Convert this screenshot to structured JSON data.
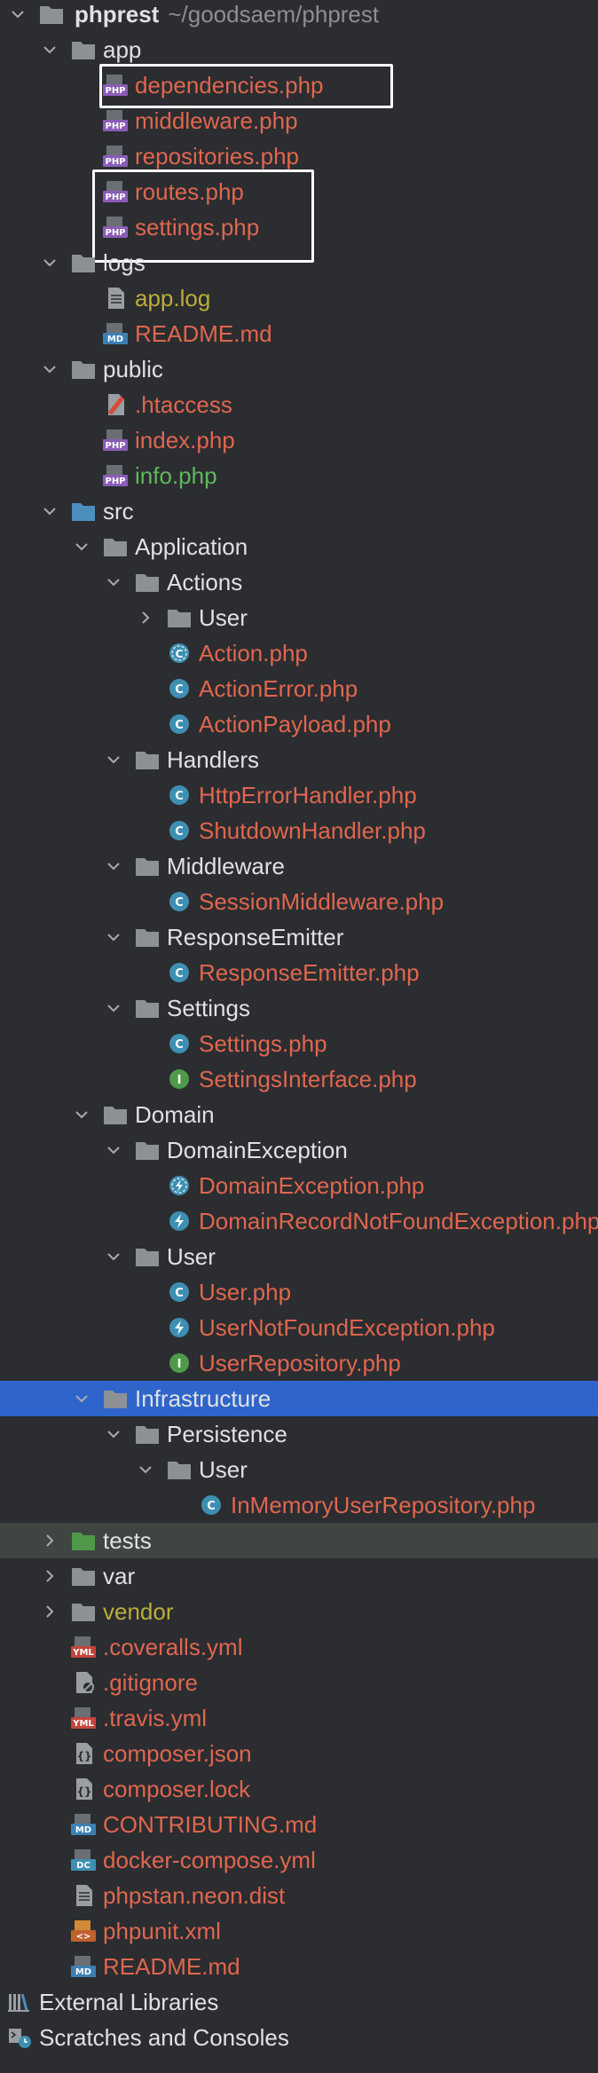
{
  "root": {
    "label": "phprest",
    "path": "~/goodsaem/phprest"
  },
  "colors": {
    "background": "#2b2d30",
    "selected_row": "#2f65ca",
    "highlight_row": "#3f4541",
    "modified_file": "#e0664f",
    "ignored_file": "#bcad3a",
    "new_file": "#5fb85c",
    "default_text": "#dfe1e5"
  },
  "rows": [
    {
      "label": "app",
      "icon": "folder-icon",
      "arrow": "expanded",
      "depth": 1,
      "color": "white"
    },
    {
      "label": "dependencies.php",
      "icon": "php-file-icon",
      "depth": 2,
      "color": "red"
    },
    {
      "label": "middleware.php",
      "icon": "php-file-icon",
      "depth": 2,
      "color": "red"
    },
    {
      "label": "repositories.php",
      "icon": "php-file-icon",
      "depth": 2,
      "color": "red"
    },
    {
      "label": "routes.php",
      "icon": "php-file-icon",
      "depth": 2,
      "color": "red"
    },
    {
      "label": "settings.php",
      "icon": "php-file-icon",
      "depth": 2,
      "color": "red"
    },
    {
      "label": "logs",
      "icon": "folder-icon",
      "arrow": "expanded",
      "depth": 1,
      "color": "white"
    },
    {
      "label": "app.log",
      "icon": "text-file-icon",
      "depth": 2,
      "color": "yellow"
    },
    {
      "label": "README.md",
      "icon": "markdown-file-icon",
      "depth": 2,
      "color": "red"
    },
    {
      "label": "public",
      "icon": "folder-icon",
      "arrow": "expanded",
      "depth": 1,
      "color": "white"
    },
    {
      "label": ".htaccess",
      "icon": "htaccess-file-icon",
      "depth": 2,
      "color": "red"
    },
    {
      "label": "index.php",
      "icon": "php-file-icon",
      "depth": 2,
      "color": "red"
    },
    {
      "label": "info.php",
      "icon": "php-file-icon",
      "depth": 2,
      "color": "green"
    },
    {
      "label": "src",
      "icon": "source-folder-icon",
      "arrow": "expanded",
      "depth": 1,
      "color": "white"
    },
    {
      "label": "Application",
      "icon": "folder-icon",
      "arrow": "expanded",
      "depth": 2,
      "color": "white"
    },
    {
      "label": "Actions",
      "icon": "folder-icon",
      "arrow": "expanded",
      "depth": 3,
      "color": "white"
    },
    {
      "label": "User",
      "icon": "folder-icon",
      "arrow": "collapsed",
      "depth": 4,
      "color": "white"
    },
    {
      "label": "Action.php",
      "icon": "abstract-class-icon",
      "depth": 4,
      "color": "red"
    },
    {
      "label": "ActionError.php",
      "icon": "class-icon",
      "depth": 4,
      "color": "red"
    },
    {
      "label": "ActionPayload.php",
      "icon": "class-icon",
      "depth": 4,
      "color": "red"
    },
    {
      "label": "Handlers",
      "icon": "folder-icon",
      "arrow": "expanded",
      "depth": 3,
      "color": "white"
    },
    {
      "label": "HttpErrorHandler.php",
      "icon": "class-icon",
      "depth": 4,
      "color": "red"
    },
    {
      "label": "ShutdownHandler.php",
      "icon": "class-icon",
      "depth": 4,
      "color": "red"
    },
    {
      "label": "Middleware",
      "icon": "folder-icon",
      "arrow": "expanded",
      "depth": 3,
      "color": "white"
    },
    {
      "label": "SessionMiddleware.php",
      "icon": "class-icon",
      "depth": 4,
      "color": "red"
    },
    {
      "label": "ResponseEmitter",
      "icon": "folder-icon",
      "arrow": "expanded",
      "depth": 3,
      "color": "white"
    },
    {
      "label": "ResponseEmitter.php",
      "icon": "class-icon",
      "depth": 4,
      "color": "red"
    },
    {
      "label": "Settings",
      "icon": "folder-icon",
      "arrow": "expanded",
      "depth": 3,
      "color": "white"
    },
    {
      "label": "Settings.php",
      "icon": "class-icon",
      "depth": 4,
      "color": "red"
    },
    {
      "label": "SettingsInterface.php",
      "icon": "interface-icon",
      "depth": 4,
      "color": "red"
    },
    {
      "label": "Domain",
      "icon": "folder-icon",
      "arrow": "expanded",
      "depth": 2,
      "color": "white"
    },
    {
      "label": "DomainException",
      "icon": "folder-icon",
      "arrow": "expanded",
      "depth": 3,
      "color": "white"
    },
    {
      "label": "DomainException.php",
      "icon": "abstract-exception-icon",
      "depth": 4,
      "color": "red"
    },
    {
      "label": "DomainRecordNotFoundException.php",
      "icon": "exception-icon",
      "depth": 4,
      "color": "red"
    },
    {
      "label": "User",
      "icon": "folder-icon",
      "arrow": "expanded",
      "depth": 3,
      "color": "white"
    },
    {
      "label": "User.php",
      "icon": "class-icon",
      "depth": 4,
      "color": "red"
    },
    {
      "label": "UserNotFoundException.php",
      "icon": "exception-icon",
      "depth": 4,
      "color": "red"
    },
    {
      "label": "UserRepository.php",
      "icon": "interface-icon",
      "depth": 4,
      "color": "red"
    },
    {
      "label": "Infrastructure",
      "icon": "folder-icon",
      "arrow": "expanded",
      "depth": 2,
      "color": "white",
      "selected": true
    },
    {
      "label": "Persistence",
      "icon": "folder-icon",
      "arrow": "expanded",
      "depth": 3,
      "color": "white"
    },
    {
      "label": "User",
      "icon": "folder-icon",
      "arrow": "expanded",
      "depth": 4,
      "color": "white"
    },
    {
      "label": "InMemoryUserRepository.php",
      "icon": "class-icon",
      "depth": 5,
      "color": "red"
    },
    {
      "label": "tests",
      "icon": "test-folder-icon",
      "arrow": "collapsed",
      "depth": 1,
      "color": "white",
      "highlight": true
    },
    {
      "label": "var",
      "icon": "folder-icon",
      "arrow": "collapsed",
      "depth": 1,
      "color": "white"
    },
    {
      "label": "vendor",
      "icon": "folder-icon",
      "arrow": "collapsed",
      "depth": 1,
      "color": "yellow"
    },
    {
      "label": ".coveralls.yml",
      "icon": "yml-file-icon",
      "depth": 1,
      "color": "red"
    },
    {
      "label": ".gitignore",
      "icon": "gitignore-file-icon",
      "depth": 1,
      "color": "red"
    },
    {
      "label": ".travis.yml",
      "icon": "yml-file-icon",
      "depth": 1,
      "color": "red"
    },
    {
      "label": "composer.json",
      "icon": "json-file-icon",
      "depth": 1,
      "color": "red"
    },
    {
      "label": "composer.lock",
      "icon": "json-file-icon",
      "depth": 1,
      "color": "red"
    },
    {
      "label": "CONTRIBUTING.md",
      "icon": "markdown-file-icon",
      "depth": 1,
      "color": "red"
    },
    {
      "label": "docker-compose.yml",
      "icon": "docker-compose-file-icon",
      "depth": 1,
      "color": "red"
    },
    {
      "label": "phpstan.neon.dist",
      "icon": "text-file-icon",
      "depth": 1,
      "color": "red"
    },
    {
      "label": "phpunit.xml",
      "icon": "xml-file-icon",
      "depth": 1,
      "color": "red"
    },
    {
      "label": "README.md",
      "icon": "markdown-file-icon",
      "depth": 1,
      "color": "red"
    },
    {
      "label": "External Libraries",
      "icon": "libraries-icon",
      "arrow": "collapsed",
      "depth": 0,
      "color": "white"
    },
    {
      "label": "Scratches and Consoles",
      "icon": "scratches-icon",
      "depth": 0,
      "color": "white"
    }
  ]
}
